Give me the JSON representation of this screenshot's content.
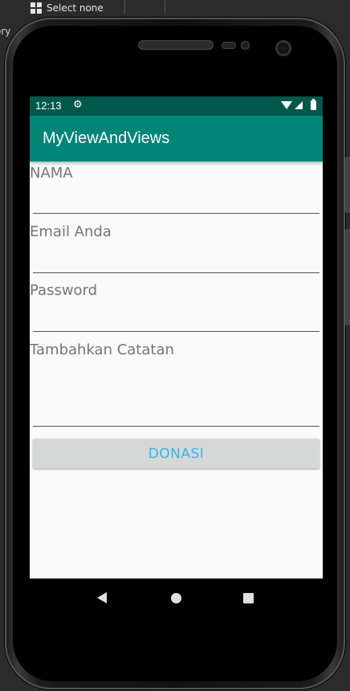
{
  "ide": {
    "select_none_label": "Select none",
    "side_text": "ory"
  },
  "status_bar": {
    "time": "12:13",
    "settings_icon": "gear-icon",
    "wifi_icon": "wifi-icon",
    "signal_icon": "signal-icon",
    "battery_icon": "battery-icon"
  },
  "app_bar": {
    "title": "MyViewAndViews"
  },
  "form": {
    "nama_label": "NAMA",
    "email_label": "Email Anda",
    "password_label": "Password",
    "notes_label": "Tambahkan Catatan",
    "donate_label": "DONASI"
  },
  "colors": {
    "status_bar": "#00574b",
    "app_bar": "#008577",
    "button_text": "#33b5e5",
    "button_bg": "#d6d7d7",
    "screen_bg": "#fafafa"
  }
}
